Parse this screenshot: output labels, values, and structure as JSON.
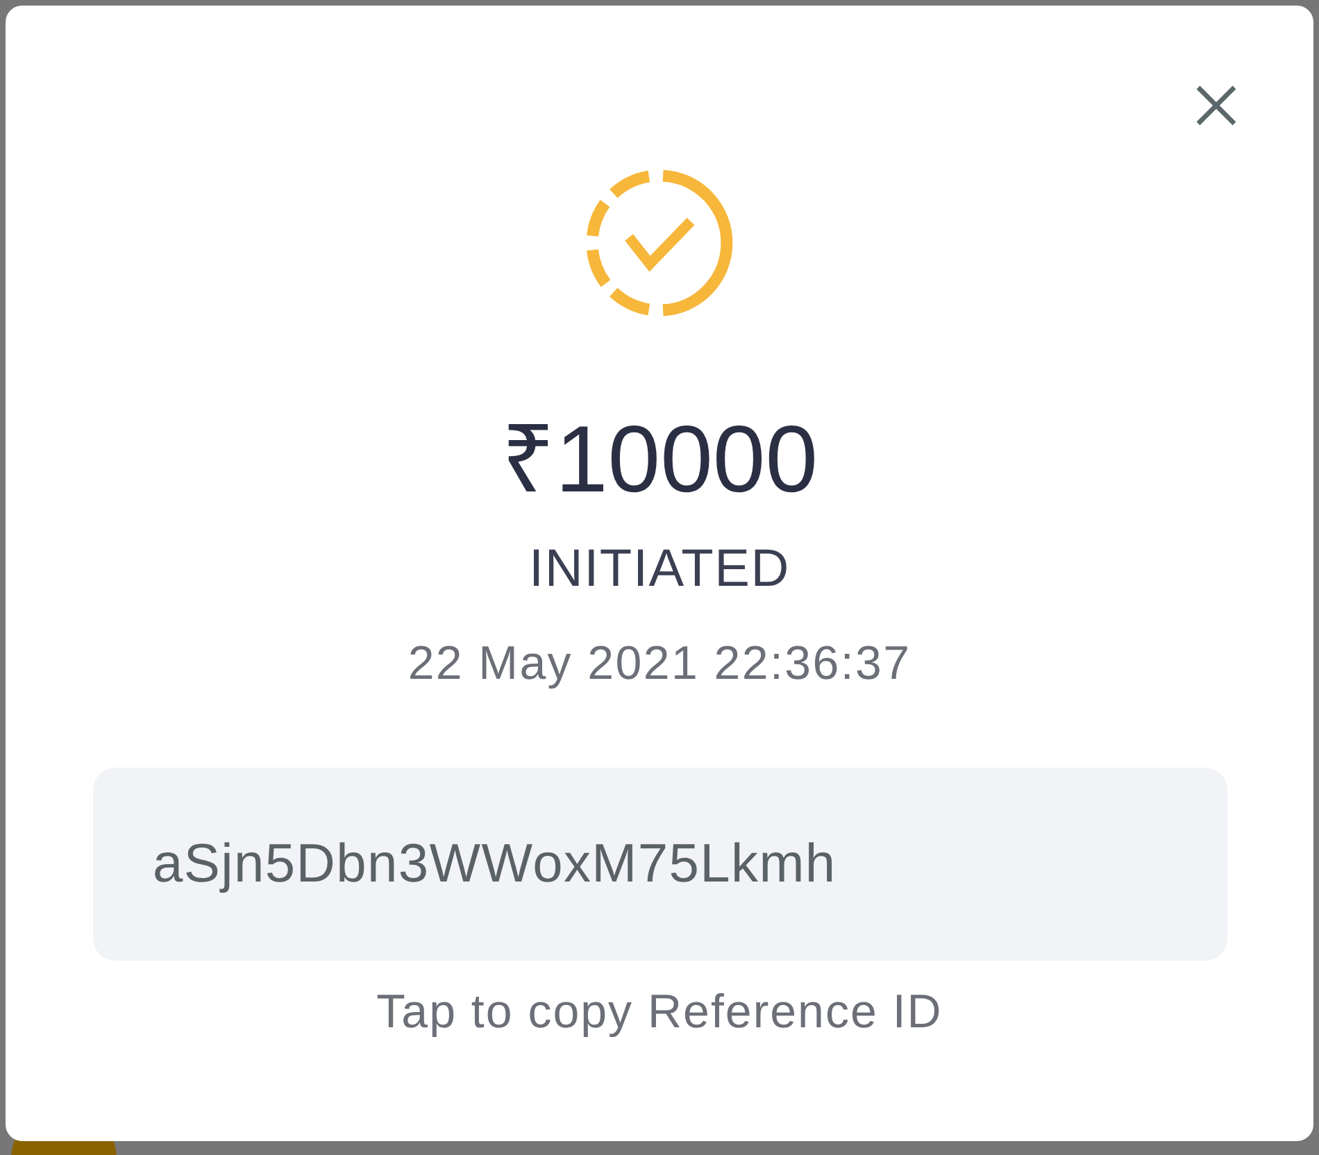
{
  "dialog": {
    "amount": "₹10000",
    "status": "INITIATED",
    "timestamp": "22 May 2021 22:36:37",
    "reference_id": "aSjn5Dbn3WWoxM75Lkmh",
    "copy_hint": "Tap to copy Reference ID"
  }
}
